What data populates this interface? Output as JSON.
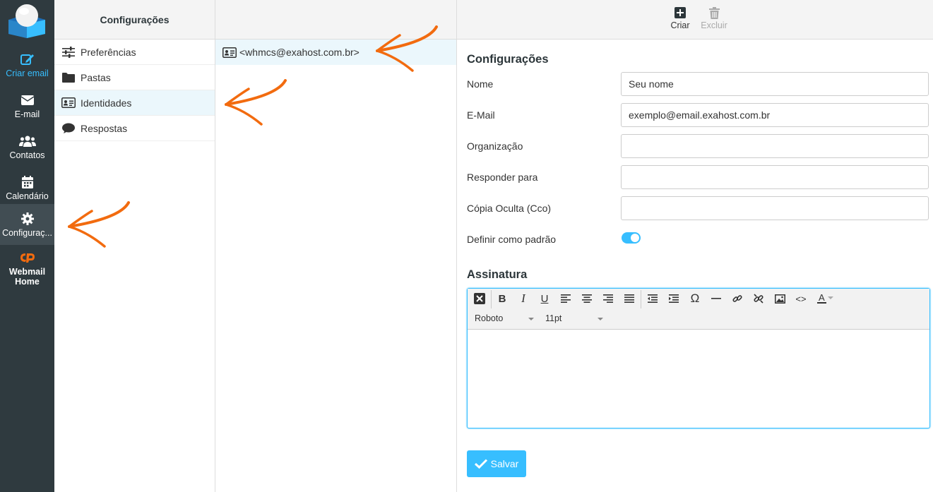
{
  "nav": {
    "items": [
      {
        "label": "Criar email",
        "icon": "compose-icon"
      },
      {
        "label": "E-mail",
        "icon": "envelope-icon"
      },
      {
        "label": "Contatos",
        "icon": "users-icon"
      },
      {
        "label": "Calendário",
        "icon": "calendar-icon"
      },
      {
        "label": "Configuraç...",
        "icon": "gear-icon"
      },
      {
        "label": "Webmail",
        "label2": "Home",
        "icon": "cpanel-icon"
      }
    ]
  },
  "settings_menu": {
    "title": "Configurações",
    "items": [
      {
        "label": "Preferências",
        "icon": "sliders-icon"
      },
      {
        "label": "Pastas",
        "icon": "folder-icon"
      },
      {
        "label": "Identidades",
        "icon": "id-card-icon"
      },
      {
        "label": "Respostas",
        "icon": "comment-icon"
      }
    ]
  },
  "identities": {
    "items": [
      {
        "label": "<whmcs@exahost.com.br>",
        "icon": "id-card-icon"
      }
    ]
  },
  "toolbar": {
    "create_label": "Criar",
    "delete_label": "Excluir"
  },
  "form": {
    "title": "Configurações",
    "name_label": "Nome",
    "name_value": "Seu nome",
    "email_label": "E-Mail",
    "email_value": "exemplo@email.exahost.com.br",
    "organization_label": "Organização",
    "organization_value": "",
    "reply_to_label": "Responder para",
    "reply_to_value": "",
    "bcc_label": "Cópia Oculta (Cco)",
    "bcc_value": "",
    "default_label": "Definir como padrão",
    "default_checked": true
  },
  "signature": {
    "title": "Assinatura",
    "font_family": "Roboto",
    "font_size": "11pt"
  },
  "save_label": "Salvar",
  "colors": {
    "accent": "#37beff",
    "nav_bg": "#2f3a3f",
    "annotation_arrow": "#f26b0f"
  }
}
